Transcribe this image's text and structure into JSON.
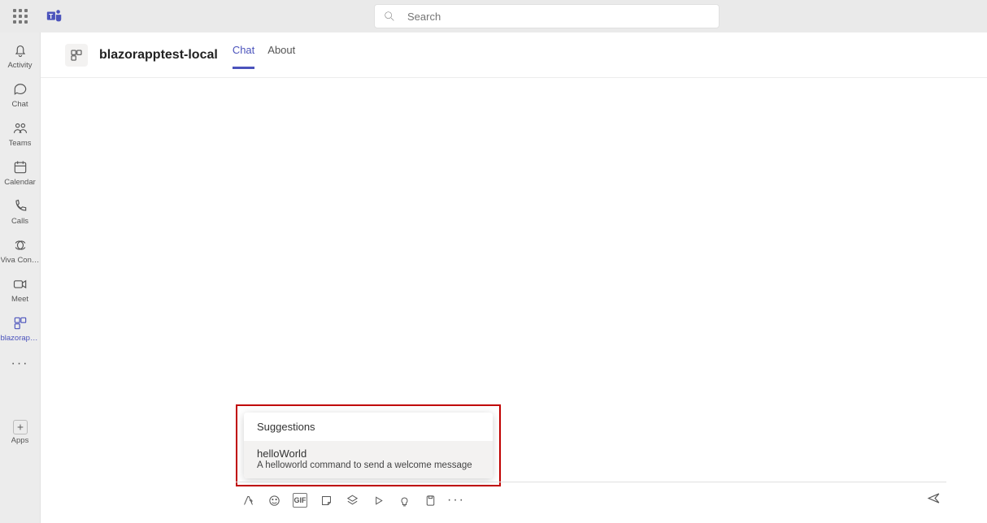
{
  "search": {
    "placeholder": "Search"
  },
  "rail": {
    "items": [
      {
        "label": "Activity",
        "icon": "bell"
      },
      {
        "label": "Chat",
        "icon": "chat"
      },
      {
        "label": "Teams",
        "icon": "people"
      },
      {
        "label": "Calendar",
        "icon": "calendar"
      },
      {
        "label": "Calls",
        "icon": "phone"
      },
      {
        "label": "Viva Connec...",
        "icon": "loop"
      },
      {
        "label": "Meet",
        "icon": "video"
      },
      {
        "label": "blazorappt...",
        "icon": "appsquares",
        "active": true
      }
    ],
    "more": "...",
    "apps": {
      "label": "Apps",
      "icon": "plusbox"
    }
  },
  "chat": {
    "appTitle": "blazorapptest-local",
    "tabs": [
      {
        "label": "Chat",
        "active": true
      },
      {
        "label": "About",
        "active": false
      }
    ]
  },
  "suggestions": {
    "header": "Suggestions",
    "items": [
      {
        "title": "helloWorld",
        "desc": "A helloworld command to send a welcome message"
      }
    ]
  },
  "compose": {
    "tools": [
      "format",
      "emoji",
      "gif",
      "sticker",
      "extensions",
      "stream",
      "schedule",
      "bulb",
      "attach",
      "more"
    ],
    "gifLabel": "GIF"
  }
}
